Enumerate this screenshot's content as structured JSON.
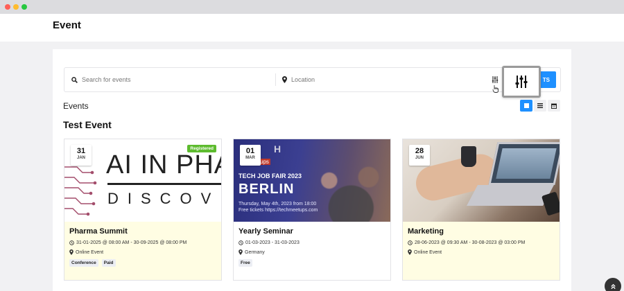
{
  "header": {
    "title": "Event"
  },
  "search": {
    "placeholder": "Search for events",
    "location_placeholder": "Location",
    "button_label": "TS"
  },
  "events_label": "Events",
  "section_title": "Test Event",
  "colors": {
    "accent": "#1e90ff",
    "registered": "#5dbb2e",
    "card_highlight": "#fffde3"
  },
  "cards": [
    {
      "day": "31",
      "month": "JAN",
      "badge": "Registered",
      "image_text_1": "AI IN PHA",
      "image_text_2": "DISCOV",
      "title": "Pharma Summit",
      "datetime": "31-01-2025 @ 08:00 AM - 30-09-2025 @ 08:00 PM",
      "location": "Online Event",
      "tags": [
        "Conference",
        "Paid"
      ]
    },
    {
      "day": "01",
      "month": "MAR",
      "image_logo": "ups",
      "image_top": "H",
      "image_text_1": "TECH JOB FAIR 2023",
      "image_text_2": "BERLIN",
      "image_text_3": "Thursday, May 4th, 2023 from 18:00",
      "image_text_4": "Free tickets https://techmeetups.com",
      "title": "Yearly Seminar",
      "datetime": "01-03-2023 - 31-03-2023",
      "location": "Germany",
      "tags": [
        "Free"
      ]
    },
    {
      "day": "28",
      "month": "JUN",
      "title": "Marketing",
      "datetime": "28-06-2023 @ 09:30 AM - 30-08-2023 @ 03:00 PM",
      "location": "Online Event",
      "tags": []
    }
  ]
}
